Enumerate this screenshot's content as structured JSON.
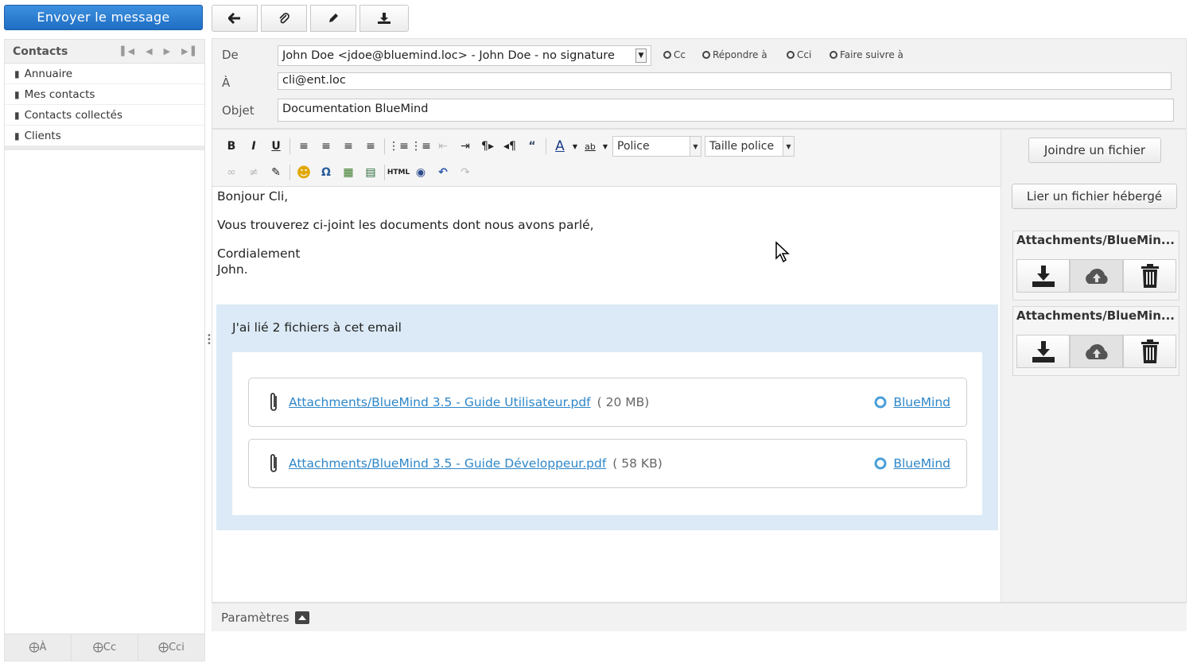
{
  "send_button": "Envoyer le message",
  "toolbar": {
    "icons": [
      "arrow-left-icon",
      "paperclip-icon",
      "pencil-icon",
      "download-icon"
    ]
  },
  "contacts": {
    "title": "Contacts",
    "items": [
      "Annuaire",
      "Mes contacts",
      "Contacts collectés",
      "Clients"
    ],
    "recipient_buttons": [
      "À",
      "Cc",
      "Cci"
    ]
  },
  "header": {
    "from_label": "De",
    "from_value": "John Doe <jdoe@bluemind.loc> - John Doe - no signature",
    "options": [
      "Cc",
      "Répondre à",
      "Cci",
      "Faire suivre à"
    ],
    "to_label": "À",
    "to_value": "cli@ent.loc",
    "subject_label": "Objet",
    "subject_value": "Documentation BlueMind"
  },
  "editor": {
    "font_select": "Police",
    "size_select": "Taille police",
    "html_label": "HTML",
    "body": {
      "greeting": "Bonjour Cli,",
      "line1": "Vous trouverez ci-joint les documents dont nous avons parlé,",
      "closing": "Cordialement",
      "signature": "John."
    }
  },
  "linked_files": {
    "title": "J'ai lié 2 fichiers à cet email",
    "files": [
      {
        "name": "Attachments/BlueMind 3.5 - Guide Utilisateur.pdf",
        "size": "( 20 MB)",
        "source": "BlueMind"
      },
      {
        "name": "Attachments/BlueMind 3.5 - Guide Développeur.pdf",
        "size": "( 58 KB)",
        "source": "BlueMind"
      }
    ]
  },
  "params_label": "Paramètres",
  "right_panel": {
    "attach_button": "Joindre un fichier",
    "link_button": "Lier un fichier hébergé",
    "attachments": [
      {
        "title": "Attachments/BlueMin..."
      },
      {
        "title": "Attachments/BlueMin..."
      }
    ]
  },
  "colors": {
    "send_button": "#2a7fd4",
    "link": "#2f87c8",
    "linked_box": "#dbeaf6"
  }
}
